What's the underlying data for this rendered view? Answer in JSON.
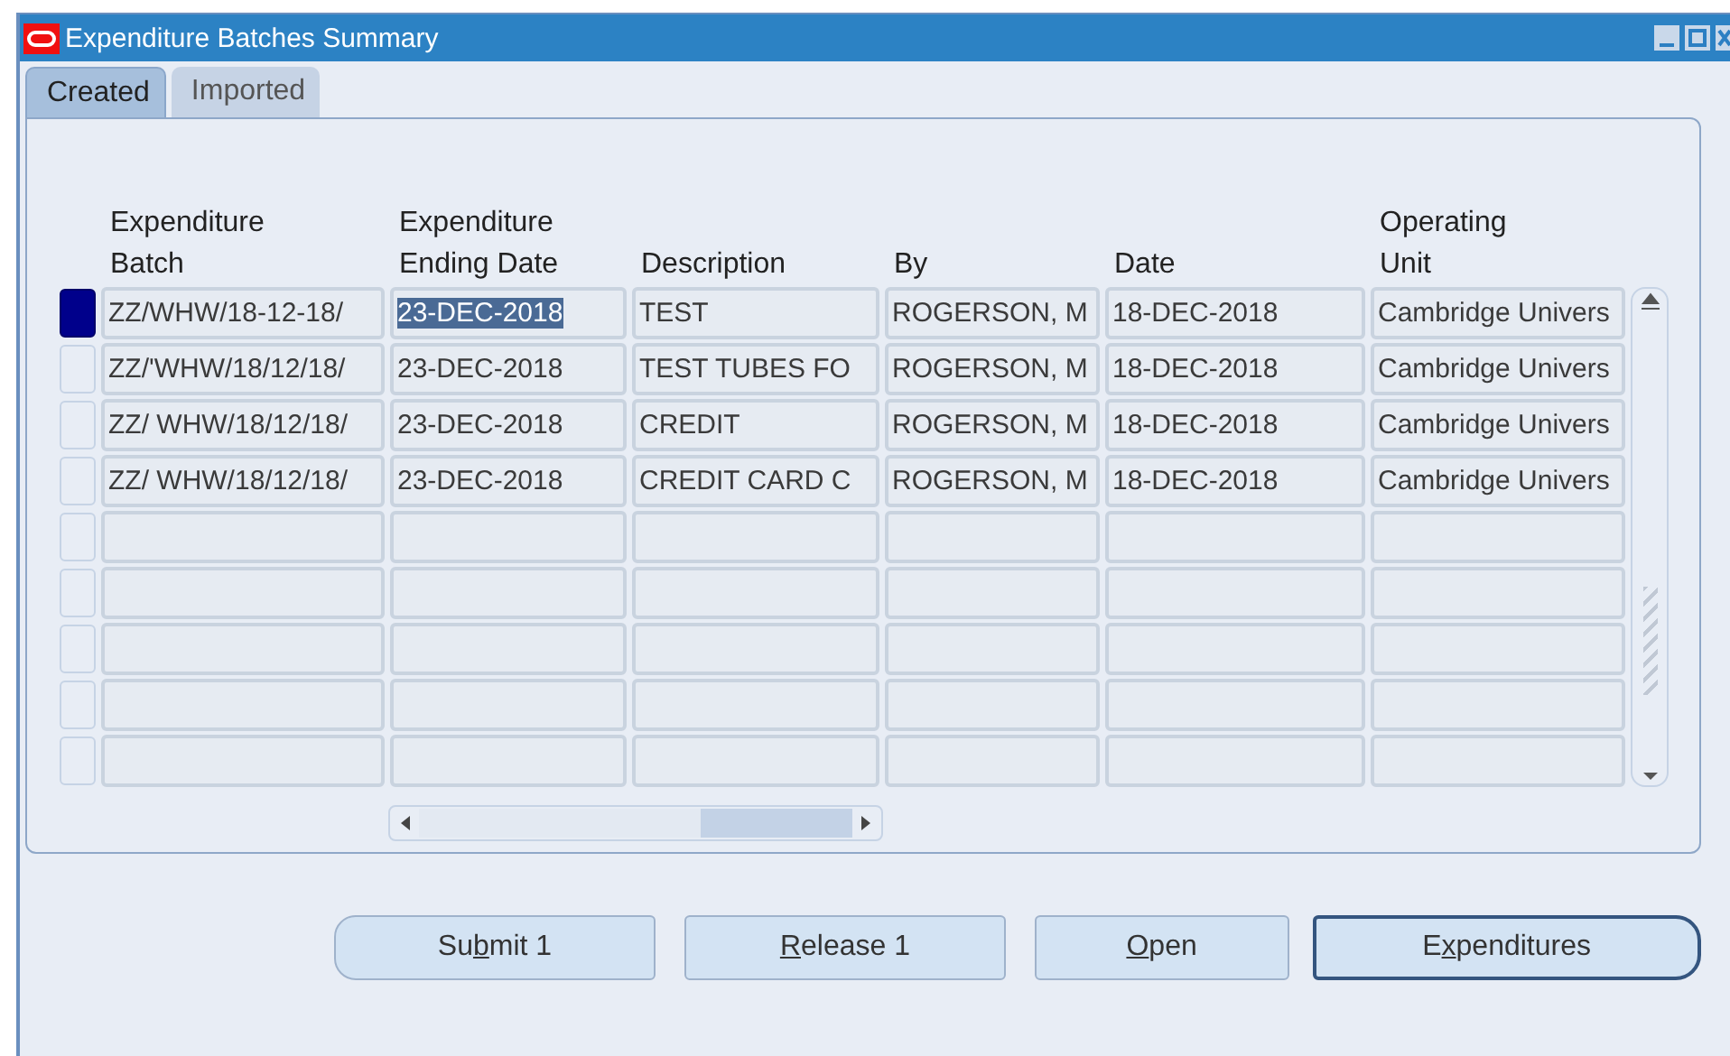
{
  "window": {
    "title": "Expenditure Batches Summary"
  },
  "tabs": [
    {
      "label": "Created",
      "selected": true
    },
    {
      "label": "Imported",
      "selected": false
    }
  ],
  "table": {
    "columns": [
      "Expenditure Batch",
      "Expenditure Ending Date",
      "Description",
      "By",
      "Date",
      "Operating Unit"
    ],
    "rows": [
      {
        "selected": true,
        "cells": [
          {
            "text": "ZZ/WHW/18-12-18/",
            "selected": false
          },
          {
            "text": "23-DEC-2018",
            "selected": true
          },
          {
            "text": "TEST",
            "selected": false
          },
          {
            "text": "ROGERSON, M",
            "selected": false
          },
          {
            "text": "18-DEC-2018",
            "selected": false
          },
          {
            "text": "Cambridge Univers",
            "selected": false
          }
        ]
      },
      {
        "selected": false,
        "cells": [
          {
            "text": "ZZ/'WHW/18/12/18/",
            "selected": false
          },
          {
            "text": "23-DEC-2018",
            "selected": false
          },
          {
            "text": "TEST TUBES FO",
            "selected": false
          },
          {
            "text": "ROGERSON, M",
            "selected": false
          },
          {
            "text": "18-DEC-2018",
            "selected": false
          },
          {
            "text": "Cambridge Univers",
            "selected": false
          }
        ]
      },
      {
        "selected": false,
        "cells": [
          {
            "text": "ZZ/ WHW/18/12/18/",
            "selected": false
          },
          {
            "text": "23-DEC-2018",
            "selected": false
          },
          {
            "text": "CREDIT",
            "selected": false
          },
          {
            "text": "ROGERSON, M",
            "selected": false
          },
          {
            "text": "18-DEC-2018",
            "selected": false
          },
          {
            "text": "Cambridge Univers",
            "selected": false
          }
        ]
      },
      {
        "selected": false,
        "cells": [
          {
            "text": "ZZ/ WHW/18/12/18/",
            "selected": false
          },
          {
            "text": "23-DEC-2018",
            "selected": false
          },
          {
            "text": "CREDIT CARD C",
            "selected": false
          },
          {
            "text": "ROGERSON, M",
            "selected": false
          },
          {
            "text": "18-DEC-2018",
            "selected": false
          },
          {
            "text": "Cambridge Univers",
            "selected": false
          }
        ]
      }
    ]
  },
  "buttons": [
    {
      "pre": "Su",
      "key": "b",
      "post": "mit 1",
      "default": false
    },
    {
      "key": "R",
      "post": "elease 1",
      "default": false
    },
    {
      "key": "O",
      "post": "pen",
      "default": false
    },
    {
      "pre": "E",
      "key": "x",
      "post": "penditures",
      "default": true
    }
  ]
}
